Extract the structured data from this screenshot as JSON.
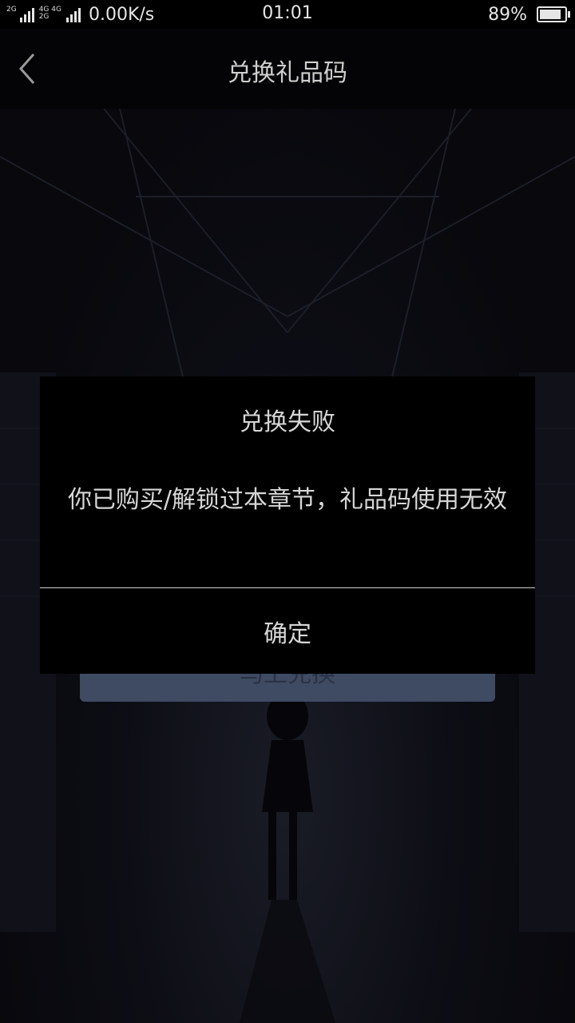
{
  "status_bar": {
    "network_left": "2G",
    "network_mid_top": "4G 4G",
    "network_mid_bottom": "2G",
    "speed": "0.00K/s",
    "time": "01:01",
    "battery": "89%"
  },
  "header": {
    "title": "兑换礼品码",
    "back_icon": "chevron-left-icon"
  },
  "main": {
    "submit_button_label": "马上兑换"
  },
  "dialog": {
    "title": "兑换失败",
    "message": "你已购买/解锁过本章节，礼品码使用无效",
    "confirm_label": "确定"
  },
  "colors": {
    "background": "#07070c",
    "dialog_bg": "#000000",
    "button_bg": "#3f4a63",
    "text": "#d6d6d6"
  }
}
